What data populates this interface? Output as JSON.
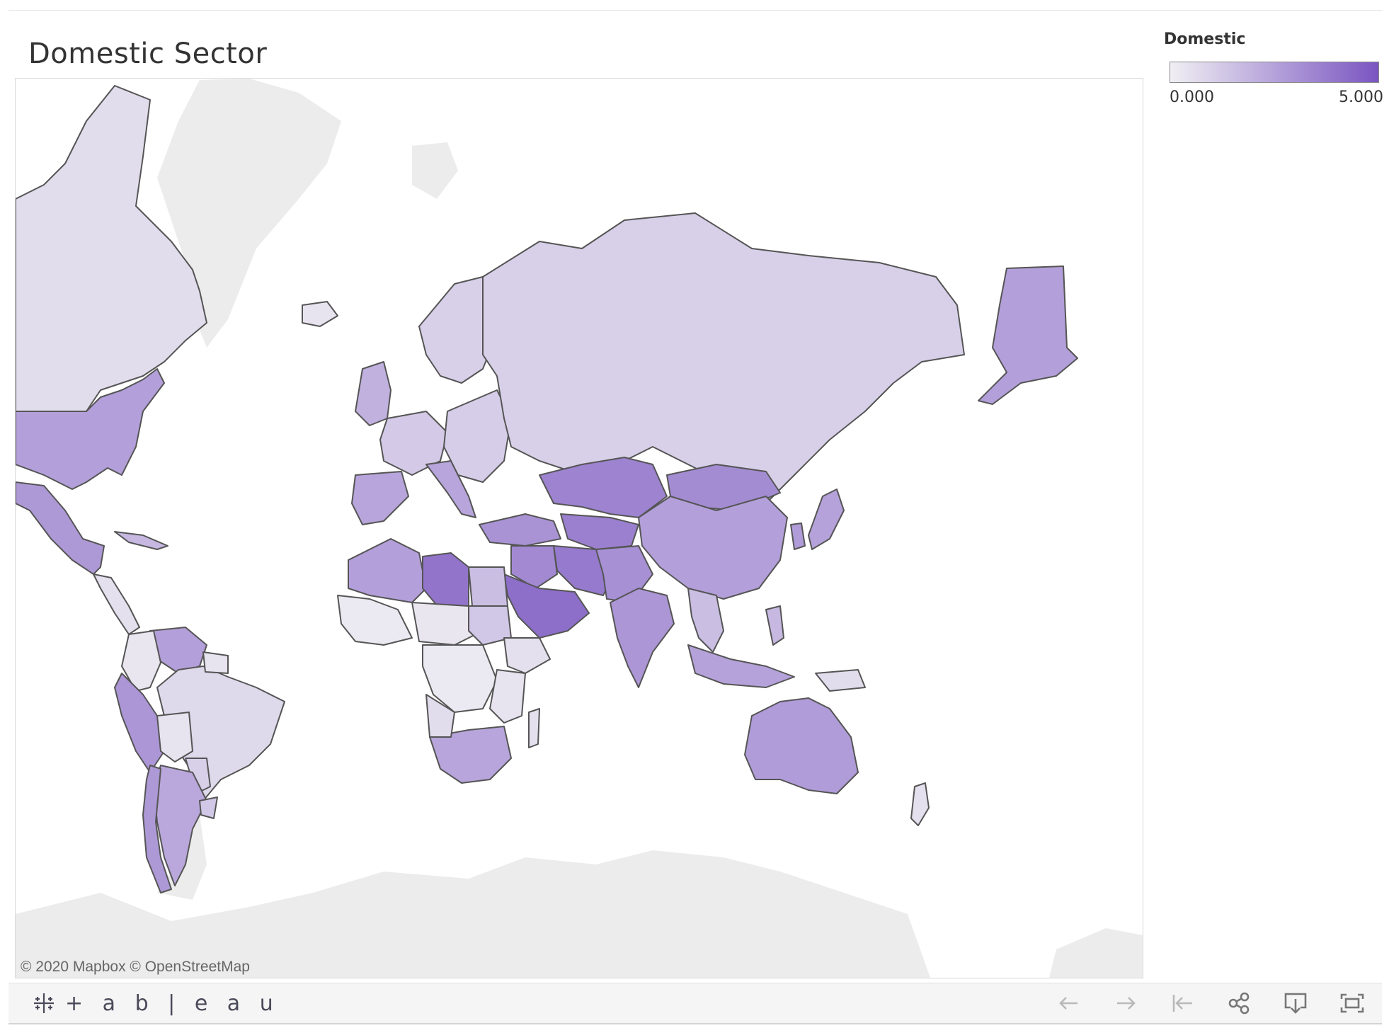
{
  "title": "Domestic Sector",
  "legend": {
    "title": "Domestic",
    "min_label": "0.000",
    "max_label": "5.000",
    "color_low": "#f0eff3",
    "color_high": "#7a55c1"
  },
  "map": {
    "attribution": "© 2020 Mapbox  © OpenStreetMap",
    "measure": "Domestic",
    "scale": [
      0,
      5
    ],
    "regions": [
      {
        "name": "Canada",
        "value": 0.6
      },
      {
        "name": "United States",
        "value": 2.6
      },
      {
        "name": "Mexico",
        "value": 2.8
      },
      {
        "name": "Central America",
        "value": 0.5
      },
      {
        "name": "Cuba",
        "value": 1.8
      },
      {
        "name": "Venezuela",
        "value": 2.6
      },
      {
        "name": "Colombia",
        "value": 0.3
      },
      {
        "name": "Peru",
        "value": 2.9
      },
      {
        "name": "Brazil",
        "value": 0.7
      },
      {
        "name": "Bolivia",
        "value": 0.4
      },
      {
        "name": "Paraguay",
        "value": 1.0
      },
      {
        "name": "Argentina",
        "value": 2.3
      },
      {
        "name": "Chile",
        "value": 2.8
      },
      {
        "name": "Uruguay",
        "value": 1.3
      },
      {
        "name": "Guyana / Suriname",
        "value": 0.4
      },
      {
        "name": "Alaska",
        "value": 2.6
      },
      {
        "name": "Iceland",
        "value": 0.4
      },
      {
        "name": "Western Europe",
        "value": 1.2
      },
      {
        "name": "Spain / Portugal",
        "value": 2.4
      },
      {
        "name": "Italy",
        "value": 2.4
      },
      {
        "name": "Scandinavia",
        "value": 1.0
      },
      {
        "name": "Eastern Europe",
        "value": 1.1
      },
      {
        "name": "United Kingdom / Ireland",
        "value": 2.0
      },
      {
        "name": "Russia",
        "value": 1.0
      },
      {
        "name": "Turkey",
        "value": 3.0
      },
      {
        "name": "Kazakhstan",
        "value": 3.5
      },
      {
        "name": "Central Asia",
        "value": 3.6
      },
      {
        "name": "Iran",
        "value": 3.8
      },
      {
        "name": "Iraq / Syria",
        "value": 3.3
      },
      {
        "name": "Saudi Arabia",
        "value": 4.2
      },
      {
        "name": "Afghanistan / Pakistan",
        "value": 3.1
      },
      {
        "name": "Mongolia",
        "value": 3.2
      },
      {
        "name": "China",
        "value": 2.6
      },
      {
        "name": "India",
        "value": 2.9
      },
      {
        "name": "Southeast Asia",
        "value": 1.6
      },
      {
        "name": "Japan",
        "value": 2.5
      },
      {
        "name": "Korea",
        "value": 2.7
      },
      {
        "name": "Indonesia",
        "value": 2.5
      },
      {
        "name": "Philippines",
        "value": 1.8
      },
      {
        "name": "Papua New Guinea",
        "value": 0.6
      },
      {
        "name": "Morocco / Algeria",
        "value": 2.6
      },
      {
        "name": "Libya",
        "value": 4.0
      },
      {
        "name": "Egypt",
        "value": 1.6
      },
      {
        "name": "West Africa",
        "value": 0.2
      },
      {
        "name": "Sahel",
        "value": 0.3
      },
      {
        "name": "Central Africa",
        "value": 0.2
      },
      {
        "name": "Sudan",
        "value": 1.3
      },
      {
        "name": "Ethiopia / Horn",
        "value": 0.5
      },
      {
        "name": "East Africa",
        "value": 0.4
      },
      {
        "name": "Southern Africa",
        "value": 2.4
      },
      {
        "name": "Angola",
        "value": 0.6
      },
      {
        "name": "Madagascar",
        "value": 0.5
      },
      {
        "name": "Australia",
        "value": 2.7
      },
      {
        "name": "New Zealand",
        "value": 0.5
      }
    ]
  },
  "toolbar": {
    "brand": "+ a b | e a u",
    "buttons": [
      "undo",
      "redo",
      "revert",
      "share",
      "download",
      "fullscreen"
    ]
  }
}
